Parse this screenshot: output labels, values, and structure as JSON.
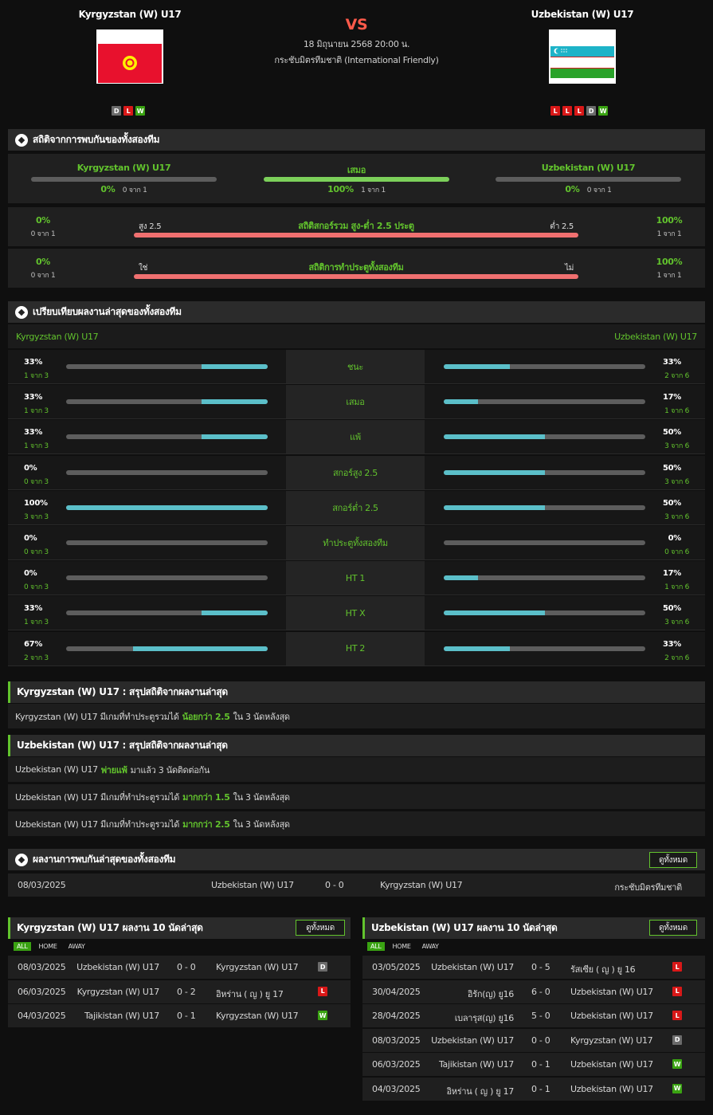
{
  "header": {
    "home_team": "Kyrgyzstan (W) U17",
    "away_team": "Uzbekistan (W) U17",
    "vs": "VS",
    "date": "18 มิถุนายน 2568 20:00 น.",
    "competition": "กระชับมิตรทีมชาติ (International Friendly)",
    "home_form": [
      "D",
      "L",
      "W"
    ],
    "away_form": [
      "L",
      "L",
      "L",
      "D",
      "W"
    ]
  },
  "h2h_stats": {
    "title": "สถิติจากการพบกันของทั้งสองทีม",
    "home": {
      "name": "Kyrgyzstan (W) U17",
      "pct": "0%",
      "count": "0 จาก 1"
    },
    "draw": {
      "name": "เสมอ",
      "pct": "100%",
      "count": "1 จาก 1"
    },
    "away": {
      "name": "Uzbekistan (W) U17",
      "pct": "0%",
      "count": "0 จาก 1"
    },
    "ou": {
      "title": "สถิติสกอร์รวม สูง-ต่ำ 2.5 ประตู",
      "left_label": "สูง 2.5",
      "right_label": "ต่ำ 2.5",
      "left_pct": "0%",
      "left_count": "0 จาก 1",
      "right_pct": "100%",
      "right_count": "1 จาก 1"
    },
    "btts": {
      "title": "สถิติการทำประตูทั้งสองทีม",
      "left_label": "ใช่",
      "right_label": "ไม่",
      "left_pct": "0%",
      "left_count": "0 จาก 1",
      "right_pct": "100%",
      "right_count": "1 จาก 1"
    }
  },
  "compare": {
    "title": "เปรียบเทียบผลงานล่าสุดของทั้งสองทีม",
    "home_name": "Kyrgyzstan (W) U17",
    "away_name": "Uzbekistan (W) U17",
    "rows": [
      {
        "label": "ชนะ",
        "lp": "33%",
        "lc": "1 จาก 3",
        "rp": "33%",
        "rc": "2 จาก 6",
        "lv": 0.33,
        "rv": 0.33
      },
      {
        "label": "เสมอ",
        "lp": "33%",
        "lc": "1 จาก 3",
        "rp": "17%",
        "rc": "1 จาก 6",
        "lv": 0.33,
        "rv": 0.17
      },
      {
        "label": "แพ้",
        "lp": "33%",
        "lc": "1 จาก 3",
        "rp": "50%",
        "rc": "3 จาก 6",
        "lv": 0.33,
        "rv": 0.5
      },
      {
        "label": "สกอร์สูง 2.5",
        "lp": "0%",
        "lc": "0 จาก 3",
        "rp": "50%",
        "rc": "3 จาก 6",
        "lv": 0,
        "rv": 0.5
      },
      {
        "label": "สกอร์ต่ำ 2.5",
        "lp": "100%",
        "lc": "3 จาก 3",
        "rp": "50%",
        "rc": "3 จาก 6",
        "lv": 1,
        "rv": 0.5
      },
      {
        "label": "ทำประตูทั้งสองทีม",
        "lp": "0%",
        "lc": "0 จาก 3",
        "rp": "0%",
        "rc": "0 จาก 6",
        "lv": 0,
        "rv": 0
      },
      {
        "label": "HT 1",
        "lp": "0%",
        "lc": "0 จาก 3",
        "rp": "17%",
        "rc": "1 จาก 6",
        "lv": 0,
        "rv": 0.17
      },
      {
        "label": "HT X",
        "lp": "33%",
        "lc": "1 จาก 3",
        "rp": "50%",
        "rc": "3 จาก 6",
        "lv": 0.33,
        "rv": 0.5
      },
      {
        "label": "HT 2",
        "lp": "67%",
        "lc": "2 จาก 3",
        "rp": "33%",
        "rc": "2 จาก 6",
        "lv": 0.67,
        "rv": 0.33
      }
    ]
  },
  "home_summary": {
    "title": "Kyrgyzstan (W) U17 : สรุปสถิติจากผลงานล่าสุด",
    "rows": [
      {
        "pre": "Kyrgyzstan (W) U17 มีเกมที่ทำประตูรวมได้",
        "hl": "น้อยกว่า 2.5",
        "post": "ใน 3 นัดหลังสุด"
      }
    ]
  },
  "away_summary": {
    "title": "Uzbekistan (W) U17 : สรุปสถิติจากผลงานล่าสุด",
    "rows": [
      {
        "pre": "Uzbekistan (W) U17",
        "hl": "พ่ายแพ้",
        "post": "มาแล้ว 3 นัดติดต่อกัน"
      },
      {
        "pre": "Uzbekistan (W) U17 มีเกมที่ทำประตูรวมได้",
        "hl": "มากกว่า 1.5",
        "post": "ใน 3 นัดหลังสุด"
      },
      {
        "pre": "Uzbekistan (W) U17 มีเกมที่ทำประตูรวมได้",
        "hl": "มากกว่า 2.5",
        "post": "ใน 3 นัดหลังสุด"
      }
    ]
  },
  "h2h_results": {
    "title": "ผลงานการพบกันล่าสุดของทั้งสองทีม",
    "view_all": "ดูทั้งหมด",
    "rows": [
      {
        "date": "08/03/2025",
        "home": "Uzbekistan (W) U17",
        "score": "0 - 0",
        "away": "Kyrgyzstan (W) U17",
        "comp": "กระชับมิตรทีมชาติ"
      }
    ]
  },
  "home_last": {
    "title": "Kyrgyzstan (W) U17 ผลงาน 10 นัดล่าสุด",
    "view_all": "ดูทั้งหมด",
    "tabs": [
      "ALL",
      "HOME",
      "AWAY"
    ],
    "rows": [
      {
        "date": "08/03/2025",
        "home": "Uzbekistan (W) U17",
        "score": "0 - 0",
        "away": "Kyrgyzstan (W) U17",
        "res": "D"
      },
      {
        "date": "06/03/2025",
        "home": "Kyrgyzstan (W) U17",
        "score": "0 - 2",
        "away": "อิหร่าน ( ญ ) ยู 17",
        "res": "L"
      },
      {
        "date": "04/03/2025",
        "home": "Tajikistan (W) U17",
        "score": "0 - 1",
        "away": "Kyrgyzstan (W) U17",
        "res": "W"
      }
    ]
  },
  "away_last": {
    "title": "Uzbekistan (W) U17 ผลงาน 10 นัดล่าสุด",
    "view_all": "ดูทั้งหมด",
    "tabs": [
      "ALL",
      "HOME",
      "AWAY"
    ],
    "rows": [
      {
        "date": "03/05/2025",
        "home": "Uzbekistan (W) U17",
        "score": "0 - 5",
        "away": "รัสเซีย ( ญ ) ยู 16",
        "res": "L"
      },
      {
        "date": "30/04/2025",
        "home": "อิรัก(ญ) ยู16",
        "score": "6 - 0",
        "away": "Uzbekistan (W) U17",
        "res": "L"
      },
      {
        "date": "28/04/2025",
        "home": "เบลารุส(ญ) ยู16",
        "score": "5 - 0",
        "away": "Uzbekistan (W) U17",
        "res": "L"
      },
      {
        "date": "08/03/2025",
        "home": "Uzbekistan (W) U17",
        "score": "0 - 0",
        "away": "Kyrgyzstan (W) U17",
        "res": "D"
      },
      {
        "date": "06/03/2025",
        "home": "Tajikistan (W) U17",
        "score": "0 - 1",
        "away": "Uzbekistan (W) U17",
        "res": "W"
      },
      {
        "date": "04/03/2025",
        "home": "อิหร่าน ( ญ ) ยู 17",
        "score": "0 - 1",
        "away": "Uzbekistan (W) U17",
        "res": "W"
      }
    ]
  },
  "colors": {
    "accent": "#62c32d",
    "bar_fill": "#5bbfc9",
    "bar_red": "#f07070",
    "win": "#3aa312",
    "loss": "#d91818",
    "draw": "#6b6b6b"
  }
}
